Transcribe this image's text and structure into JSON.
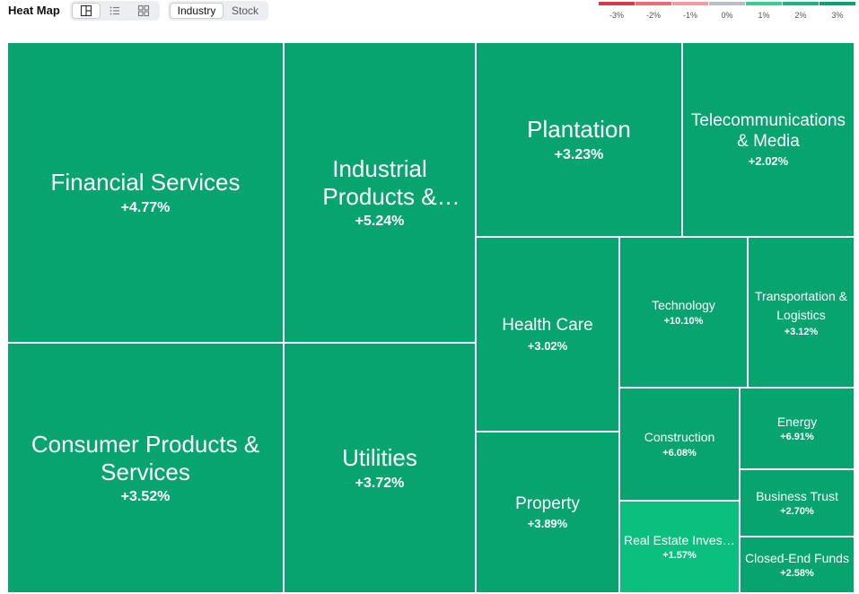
{
  "header": {
    "title": "Heat Map"
  },
  "view_toggle": {
    "selected": "treemap",
    "icons": [
      "treemap-icon",
      "list-icon",
      "grid-icon"
    ]
  },
  "mode_toggle": {
    "industry_label": "Industry",
    "stock_label": "Stock",
    "selected": "Industry"
  },
  "legend": [
    {
      "label": "-3%",
      "color": "#d93848"
    },
    {
      "label": "-2%",
      "color": "#ee6b73"
    },
    {
      "label": "-1%",
      "color": "#f49aa0"
    },
    {
      "label": "0%",
      "color": "#b9bec6"
    },
    {
      "label": "1%",
      "color": "#37cf93"
    },
    {
      "label": "2%",
      "color": "#16b57c"
    },
    {
      "label": "3%",
      "color": "#07a46f"
    }
  ],
  "tiles": {
    "financial": {
      "name": "Financial Services",
      "change": "+4.77%"
    },
    "consumer": {
      "name": "Consumer Products & Services",
      "change": "+3.52%"
    },
    "industrial": {
      "name": "Industrial Products & Services",
      "change": "+5.24%"
    },
    "utilities": {
      "name": "Utilities",
      "change": "+3.72%"
    },
    "plantation": {
      "name": "Plantation",
      "change": "+3.23%"
    },
    "telecom": {
      "name": "Telecommunications & Media",
      "change": "+2.02%"
    },
    "healthcare": {
      "name": "Health Care",
      "change": "+3.02%"
    },
    "property": {
      "name": "Property",
      "change": "+3.89%"
    },
    "technology": {
      "name": "Technology",
      "change": "+10.10%"
    },
    "transportation": {
      "name": "Transportation & Logistics",
      "change": "+3.12%"
    },
    "construction": {
      "name": "Construction",
      "change": "+6.08%"
    },
    "reit": {
      "name": "Real Estate Investment Trusts",
      "change": "+1.57%"
    },
    "energy": {
      "name": "Energy",
      "change": "+6.91%"
    },
    "business_trust": {
      "name": "Business Trust",
      "change": "+2.70%"
    },
    "closed_end": {
      "name": "Closed-End Funds",
      "change": "+2.58%"
    }
  },
  "colors": {
    "strong_green": "#07a46f",
    "light_green": "#0bc07f"
  }
}
